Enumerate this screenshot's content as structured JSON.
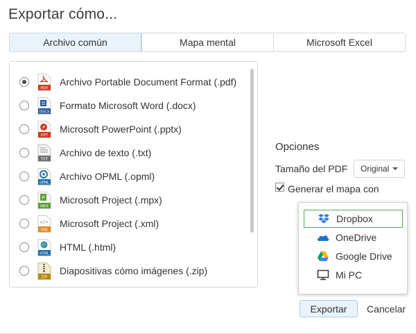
{
  "dialog": {
    "title": "Exportar cómo...",
    "tabs": [
      {
        "label": "Archivo común",
        "active": true
      },
      {
        "label": "Mapa mental",
        "active": false
      },
      {
        "label": "Microsoft Excel",
        "active": false
      }
    ],
    "formats": [
      {
        "label": "Archivo Portable Document Format (.pdf)",
        "icon": "pdf-file-icon",
        "badge": "PDF",
        "checked": true
      },
      {
        "label": "Formato Microsoft Word (.docx)",
        "icon": "docx-file-icon",
        "badge": "DOCX",
        "checked": false
      },
      {
        "label": "Microsoft PowerPoint (.pptx)",
        "icon": "pptx-file-icon",
        "badge": "PPT",
        "checked": false
      },
      {
        "label": "Archivo de texto (.txt)",
        "icon": "txt-file-icon",
        "badge": "TXT",
        "checked": false
      },
      {
        "label": "Archivo OPML (.opml)",
        "icon": "opml-file-icon",
        "badge": "OPML",
        "checked": false
      },
      {
        "label": "Microsoft Project (.mpx)",
        "icon": "mpx-file-icon",
        "badge": "MPX",
        "checked": false
      },
      {
        "label": "Microsoft Project (.xml)",
        "icon": "xml-file-icon",
        "badge": "XML",
        "checked": false
      },
      {
        "label": "HTML (.html)",
        "icon": "html-file-icon",
        "badge": "HTML",
        "checked": false
      },
      {
        "label": "Diapositivas cómo imágenes (.zip)",
        "icon": "zip-file-icon",
        "badge": "ZIP",
        "checked": false
      }
    ],
    "options": {
      "title": "Opciones",
      "pdf_size_label": "Tamaño del PDF",
      "pdf_size_value": "Original",
      "generate_checkbox_label": "Generar el mapa con",
      "generate_checkbox_checked": true
    },
    "save_targets": [
      {
        "label": "Dropbox",
        "icon": "dropbox-icon",
        "highlighted": true
      },
      {
        "label": "OneDrive",
        "icon": "onedrive-icon",
        "highlighted": false
      },
      {
        "label": "Google Drive",
        "icon": "google-drive-icon",
        "highlighted": false
      },
      {
        "label": "Mi PC",
        "icon": "monitor-icon",
        "highlighted": false
      }
    ],
    "buttons": {
      "export": "Exportar",
      "cancel": "Cancelar"
    },
    "colors": {
      "accent_bg": "#e9f3fb",
      "accent_border": "#a9cde8",
      "highlight": "#4caf50",
      "pdf_red": "#d93a2b",
      "docx_blue": "#2b5797",
      "pptx_red": "#c43e1c",
      "mpx_green": "#5a9e2f",
      "xml_orange": "#e08a1e",
      "zip_tan": "#b8860b",
      "opml_blue": "#1f6fa8"
    }
  }
}
